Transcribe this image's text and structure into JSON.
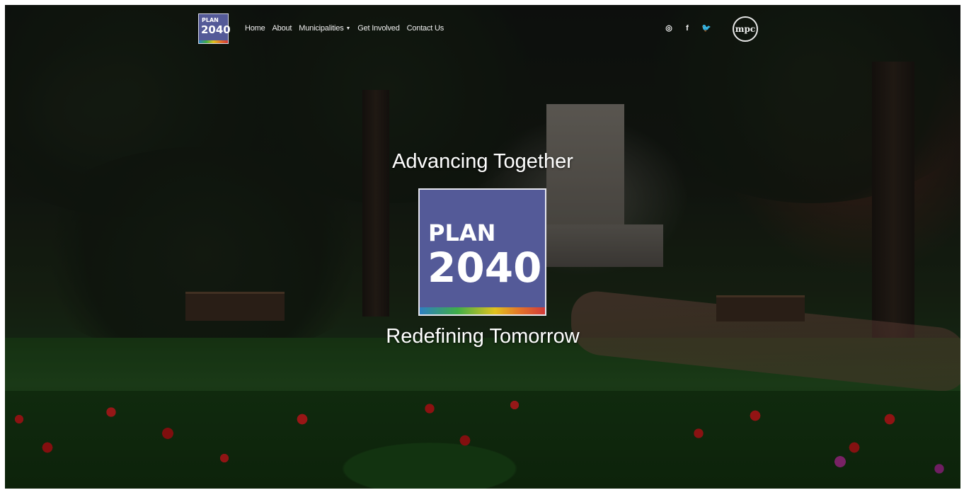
{
  "nav": {
    "logo": {
      "line1": "PLAN",
      "line2": "2040"
    },
    "items": [
      {
        "label": "Home"
      },
      {
        "label": "About"
      },
      {
        "label": "Municipalities",
        "has_dropdown": true
      },
      {
        "label": "Get Involved"
      },
      {
        "label": "Contact Us"
      }
    ],
    "social": [
      {
        "icon": "instagram-icon",
        "glyph": "◎"
      },
      {
        "icon": "facebook-icon",
        "glyph": "f"
      },
      {
        "icon": "twitter-icon",
        "glyph": "🐦"
      }
    ],
    "partner_logo": "mpc"
  },
  "hero": {
    "tagline_top": "Advancing Together",
    "logo": {
      "line1": "PLAN",
      "line2": "2040"
    },
    "tagline_bottom": "Redefining Tomorrow"
  },
  "colors": {
    "logo_bg": "#545a98",
    "spectrum": [
      "#2e7fc1",
      "#3fae49",
      "#e0c21e",
      "#e4732a",
      "#d23a3a"
    ]
  }
}
